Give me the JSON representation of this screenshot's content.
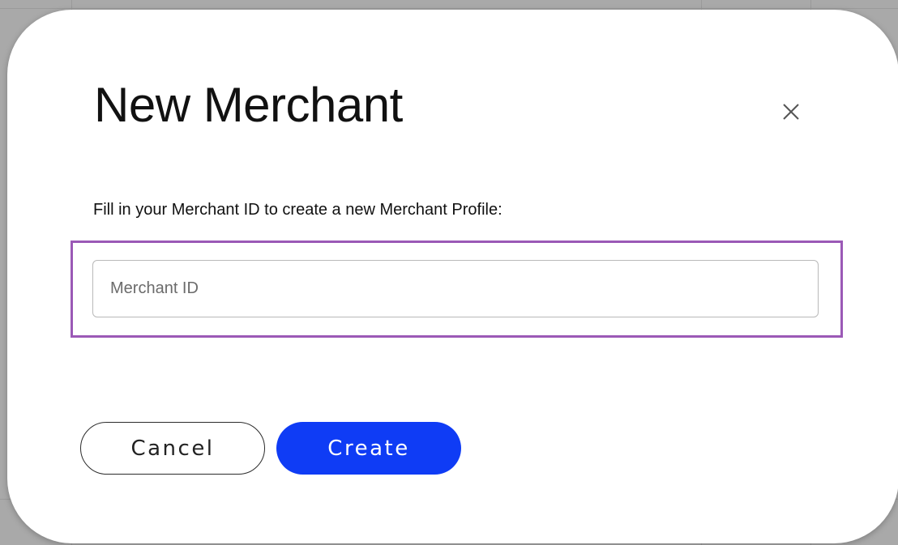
{
  "dialog": {
    "title": "New Merchant",
    "instruction": "Fill in your Merchant ID to create a new Merchant Profile:",
    "close_icon": "close-icon",
    "merchant_id_input": {
      "value": "",
      "placeholder": "Merchant ID"
    },
    "cancel_label": "Cancel",
    "create_label": "Create"
  },
  "colors": {
    "primary": "#0f3cf5",
    "focus_highlight": "#9b59b6",
    "backdrop": "#a9a9a9"
  }
}
